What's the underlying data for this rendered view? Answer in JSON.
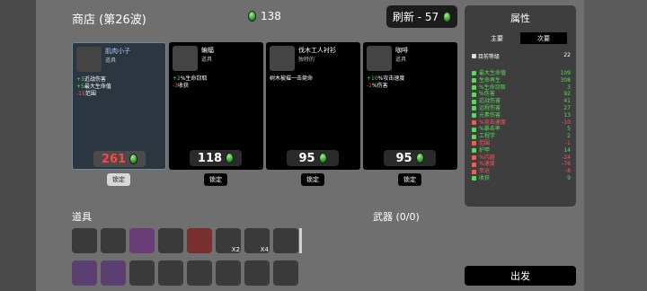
{
  "header": {
    "shop_title": "商店 (第26波)",
    "currency": "138",
    "reroll_label": "刷新 - 57"
  },
  "cards": [
    {
      "name": "肌肉小子",
      "type": "道具",
      "desc": [
        [
          "+3",
          "近战伤害",
          "g"
        ],
        [
          "+5",
          "最大生命值",
          "g"
        ],
        [
          "-15",
          "范围",
          "r"
        ]
      ],
      "price": "261",
      "icon": "muscle-arm-icon",
      "lock": "锁定"
    },
    {
      "name": "蝙蝠",
      "type": "道具",
      "desc": [
        [
          "+2",
          "%生命窃取",
          "g"
        ],
        [
          "-3",
          "收获",
          "r"
        ]
      ],
      "price": "118",
      "icon": "bat-icon",
      "lock": "锁定"
    },
    {
      "name": "伐木工人衬衫",
      "type": "独特的",
      "desc": [
        [
          "",
          "树木被摧一击毙命",
          ""
        ]
      ],
      "price": "95",
      "icon": "lumberjack-shirt-icon",
      "lock": "锁定"
    },
    {
      "name": "咖啡",
      "type": "道具",
      "desc": [
        [
          "+10",
          "%攻击速度",
          "g"
        ],
        [
          "-1",
          "%伤害",
          "r"
        ]
      ],
      "price": "95",
      "icon": "coffee-icon",
      "lock": "锁定"
    }
  ],
  "inventory": {
    "items_title": "道具",
    "weapons_title": "武器 (0/0)",
    "slots": [
      {
        "icon": "ninja-mask-icon",
        "count": "",
        "tier": "t"
      },
      {
        "icon": "crown-icon",
        "count": "",
        "tier": "t"
      },
      {
        "icon": "pig-icon",
        "count": "",
        "tier": "p"
      },
      {
        "icon": "gun-icon",
        "count": "",
        "tier": "t"
      },
      {
        "icon": "bullet-icon",
        "count": "",
        "tier": "r"
      },
      {
        "icon": "bandage-icon",
        "count": "X2",
        "tier": "t"
      },
      {
        "icon": "robot-icon",
        "count": "X4",
        "tier": "t"
      },
      {
        "icon": "poop-icon",
        "count": "",
        "tier": "t"
      },
      {
        "icon": "candle-icon",
        "count": "",
        "tier": "b"
      },
      {
        "icon": "muscle-arm-icon",
        "count": "",
        "tier": "b"
      },
      {
        "icon": "snake-icon",
        "count": "",
        "tier": "t"
      },
      {
        "icon": "turret-icon",
        "count": "",
        "tier": "t"
      },
      {
        "icon": "wheat-icon",
        "count": "",
        "tier": "t"
      },
      {
        "icon": "eye-icon",
        "count": "",
        "tier": "t"
      },
      {
        "icon": "ladder-icon",
        "count": "",
        "tier": "t"
      },
      {
        "icon": "sprout-icon",
        "count": "",
        "tier": "t"
      }
    ]
  },
  "attributes": {
    "title": "属性",
    "tab_main": "主要",
    "tab_secondary": "次要",
    "level_label": "目前等级",
    "level_value": "22",
    "stats": [
      {
        "label": "最大生命值",
        "value": "109",
        "color": "#55dd55"
      },
      {
        "label": "生命再生",
        "value": "308",
        "color": "#55dd55"
      },
      {
        "label": "%生命窃取",
        "value": "3",
        "color": "#55dd55"
      },
      {
        "label": "%伤害",
        "value": "92",
        "color": "#55dd55"
      },
      {
        "label": "近战伤害",
        "value": "41",
        "color": "#55dd55"
      },
      {
        "label": "远程伤害",
        "value": "27",
        "color": "#55dd55"
      },
      {
        "label": "元素伤害",
        "value": "13",
        "color": "#55dd55"
      },
      {
        "label": "%攻击速度",
        "value": "-10",
        "color": "#ff5555"
      },
      {
        "label": "%暴击率",
        "value": "5",
        "color": "#55dd55"
      },
      {
        "label": "工程学",
        "value": "2",
        "color": "#55dd55"
      },
      {
        "label": "范围",
        "value": "-1",
        "color": "#ff5555"
      },
      {
        "label": "护甲",
        "value": "14",
        "color": "#55dd55"
      },
      {
        "label": "%闪避",
        "value": "-24",
        "color": "#ff5555"
      },
      {
        "label": "%速度",
        "value": "-76",
        "color": "#ff5555"
      },
      {
        "label": "幸运",
        "value": "-8",
        "color": "#ff5555"
      },
      {
        "label": "收获",
        "value": "9",
        "color": "#55dd55"
      }
    ]
  },
  "go_label": "出发"
}
